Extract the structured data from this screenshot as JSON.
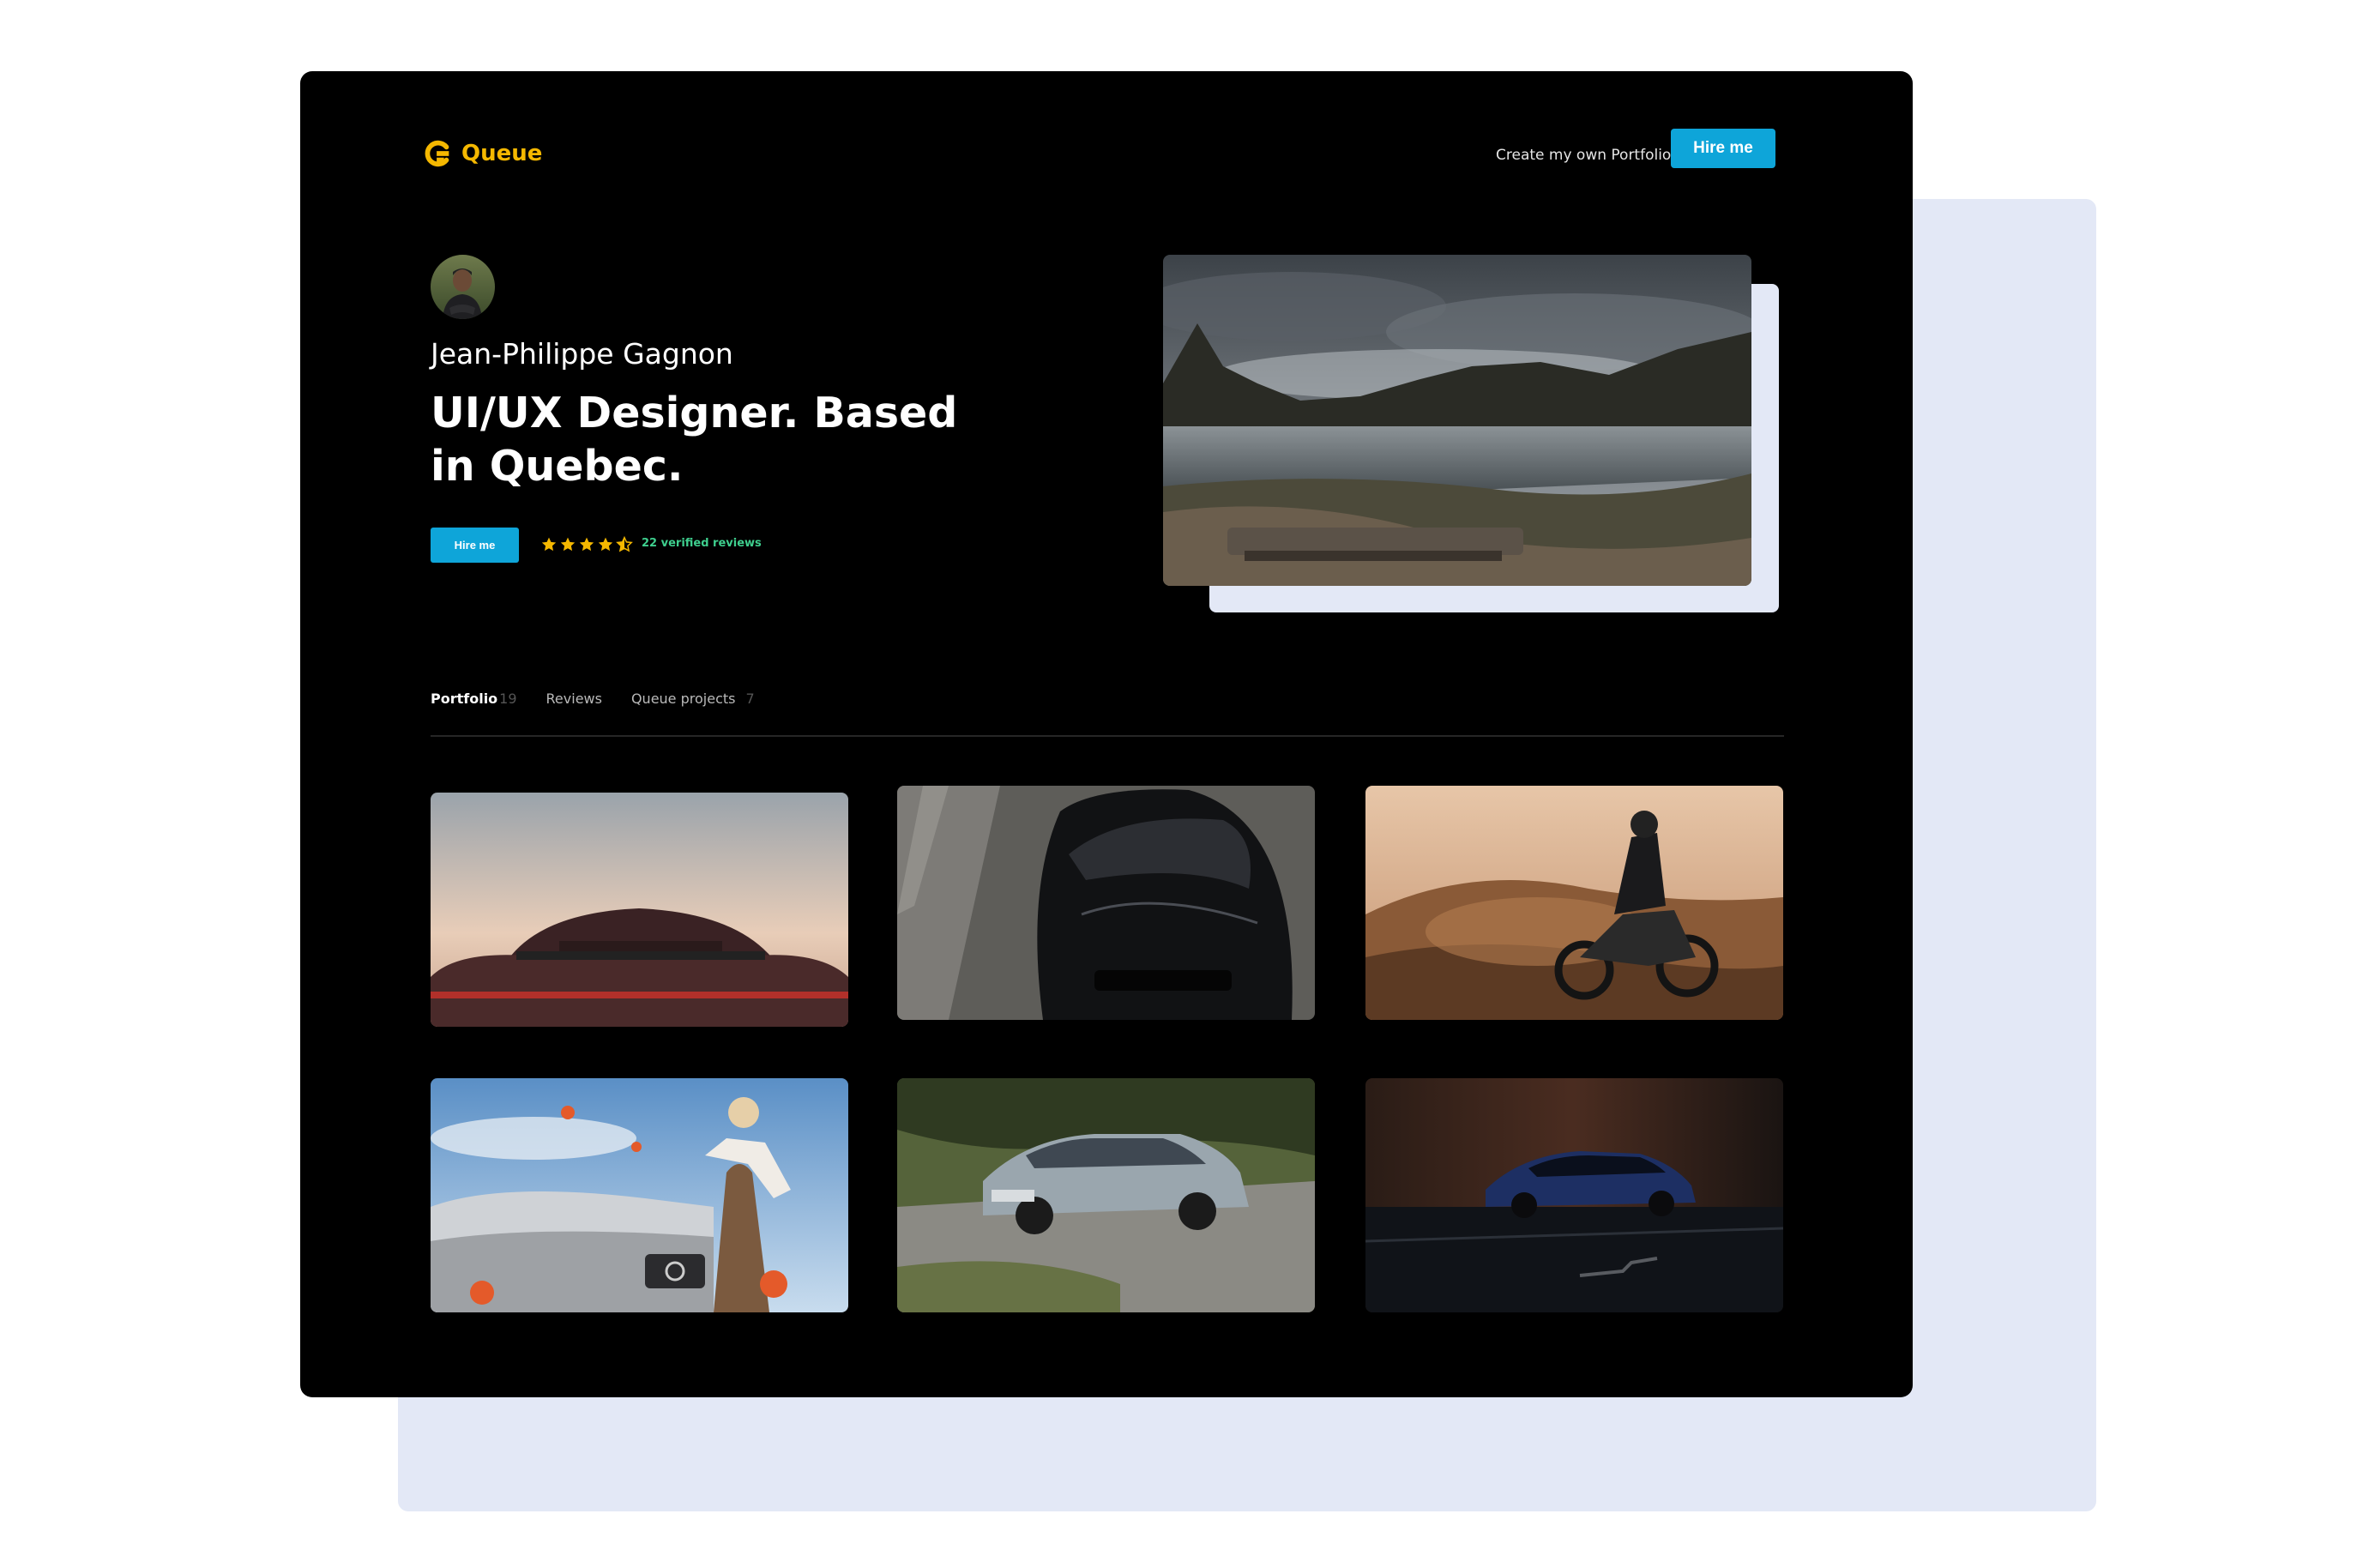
{
  "brand": {
    "name": "Queue",
    "icon": "queue-logo-icon",
    "color": "#f5b800"
  },
  "nav": {
    "create_portfolio": "Create my own Portfolio",
    "hire_label": "Hire me"
  },
  "profile": {
    "avatar": "profile-photo",
    "name": "Jean-Philippe Gagnon",
    "headline": "UI/UX Designer. Based in Quebec.",
    "hire_label": "Hire me",
    "rating": 4.5,
    "rating_max": 5,
    "reviews_text": "22 verified reviews"
  },
  "hero": {
    "image": "lake-landscape-photo"
  },
  "tabs": [
    {
      "label": "Portfolio",
      "count": "19",
      "active": true
    },
    {
      "label": "Reviews",
      "count": "",
      "active": false
    },
    {
      "label": "Queue projects",
      "count": "7",
      "active": false
    }
  ],
  "portfolio": [
    {
      "image": "porsche-rear-photo"
    },
    {
      "image": "black-sports-car-top-view-photo"
    },
    {
      "image": "motorcycle-dune-sunset-photo"
    },
    {
      "image": "volvo-woman-flowers-photo"
    },
    {
      "image": "vintage-bmw-coupe-photo"
    },
    {
      "image": "blue-sedan-night-photo"
    }
  ],
  "colors": {
    "accent": "#0ea5d9",
    "background": "#000000",
    "rating": "#f5b800",
    "reviews": "#3ecf8e",
    "backdrop": "#e3e8f6"
  }
}
